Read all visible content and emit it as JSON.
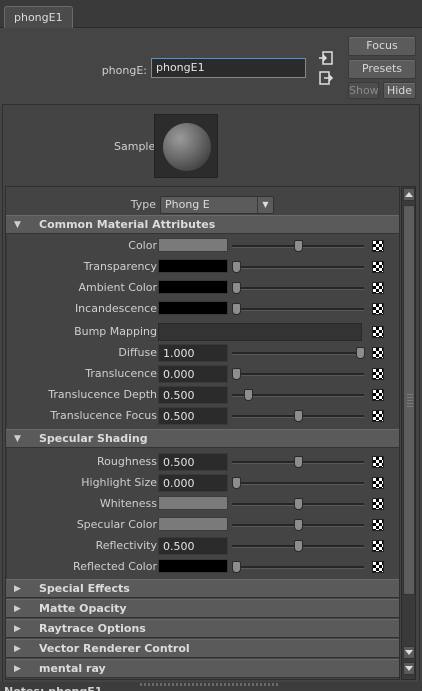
{
  "tab": {
    "label": "phongE1"
  },
  "header": {
    "node_label": "phongE:",
    "node_name": "phongE1",
    "focus_label": "Focus",
    "presets_label": "Presets",
    "show_label": "Show",
    "hide_label": "Hide"
  },
  "sample": {
    "label": "Sample"
  },
  "type_row": {
    "label": "Type",
    "value": "Phong E"
  },
  "sections": {
    "common": {
      "title": "Common Material Attributes",
      "rows": [
        {
          "label": "Color",
          "kind": "color",
          "color": "#7a7a7a",
          "slider": 0.5
        },
        {
          "label": "Transparency",
          "kind": "color",
          "color": "#000000",
          "slider": 0.0
        },
        {
          "label": "Ambient Color",
          "kind": "color",
          "color": "#000000",
          "slider": 0.0
        },
        {
          "label": "Incandescence",
          "kind": "color",
          "color": "#000000",
          "slider": 0.0
        },
        {
          "label": "Bump Mapping",
          "kind": "bump"
        },
        {
          "label": "Diffuse",
          "kind": "value",
          "value": "1.000",
          "slider": 1.0
        },
        {
          "label": "Translucence",
          "kind": "value",
          "value": "0.000",
          "slider": 0.0
        },
        {
          "label": "Translucence Depth",
          "kind": "value",
          "value": "0.500",
          "slider": 0.1
        },
        {
          "label": "Translucence Focus",
          "kind": "value",
          "value": "0.500",
          "slider": 0.5
        }
      ]
    },
    "specular": {
      "title": "Specular Shading",
      "rows": [
        {
          "label": "Roughness",
          "kind": "value",
          "value": "0.500",
          "slider": 0.5
        },
        {
          "label": "Highlight Size",
          "kind": "value",
          "value": "0.000",
          "slider": 0.0
        },
        {
          "label": "Whiteness",
          "kind": "color",
          "color": "#7a7a7a",
          "slider": 0.5
        },
        {
          "label": "Specular Color",
          "kind": "color",
          "color": "#7a7a7a",
          "slider": 0.5
        },
        {
          "label": "Reflectivity",
          "kind": "value",
          "value": "0.500",
          "slider": 0.5
        },
        {
          "label": "Reflected Color",
          "kind": "color",
          "color": "#000000",
          "slider": 0.0
        }
      ]
    },
    "collapsed": [
      "Special Effects",
      "Matte Opacity",
      "Raytrace Options",
      "Vector Renderer Control",
      "mental ray"
    ]
  },
  "bottom_cut": "Notes: phongE1"
}
